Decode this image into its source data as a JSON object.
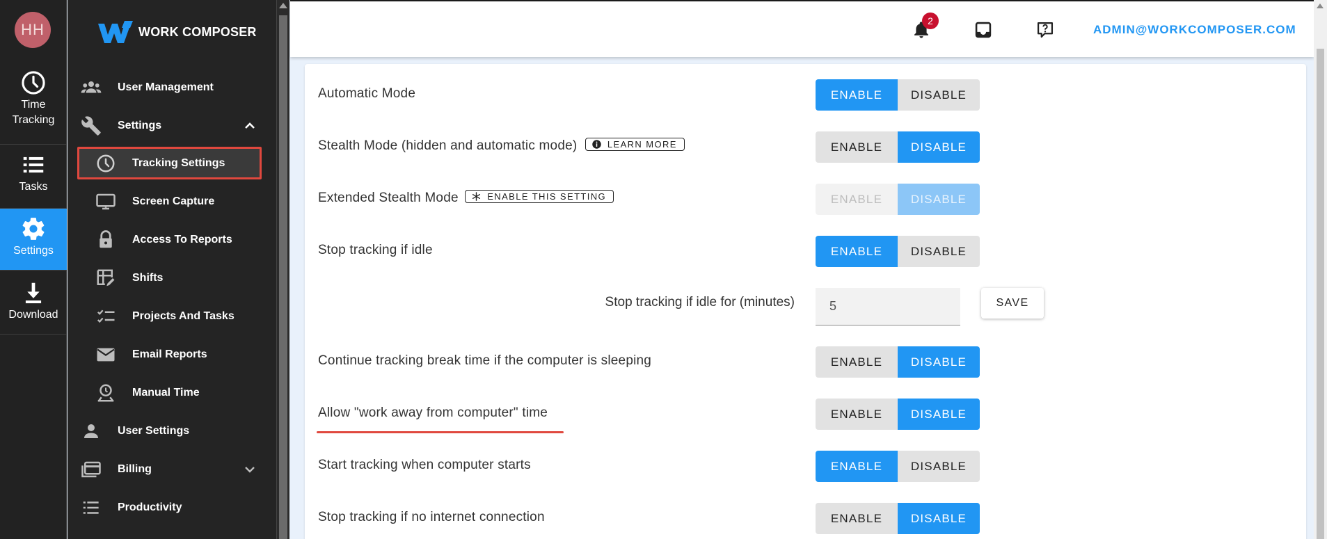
{
  "user": {
    "initials": "HH"
  },
  "rail": {
    "items": [
      {
        "label": "Time\nTracking",
        "line1": "Time",
        "line2": "Tracking",
        "icon": "clock-icon"
      },
      {
        "label": "Tasks",
        "icon": "list-icon"
      },
      {
        "label": "Settings",
        "icon": "gear-icon",
        "active": true
      },
      {
        "label": "Download",
        "icon": "download-icon"
      }
    ]
  },
  "nav": {
    "logo_text": "WORK COMPOSER",
    "items": [
      {
        "label": "User Management",
        "icon": "users-icon",
        "level": "top"
      },
      {
        "label": "Settings",
        "icon": "wrench-icon",
        "level": "top",
        "expanded": true
      },
      {
        "label": "Tracking Settings",
        "icon": "clock-icon",
        "level": "sub",
        "selected": true
      },
      {
        "label": "Screen Capture",
        "icon": "monitor-icon",
        "level": "sub"
      },
      {
        "label": "Access To Reports",
        "icon": "lock-icon",
        "level": "sub"
      },
      {
        "label": "Shifts",
        "icon": "schedule-icon",
        "level": "sub"
      },
      {
        "label": "Projects And Tasks",
        "icon": "checklist-icon",
        "level": "sub"
      },
      {
        "label": "Email Reports",
        "icon": "mail-icon",
        "level": "sub"
      },
      {
        "label": "Manual Time",
        "icon": "manual-time-icon",
        "level": "sub"
      },
      {
        "label": "User Settings",
        "icon": "person-icon",
        "level": "top"
      },
      {
        "label": "Billing",
        "icon": "billing-icon",
        "level": "top",
        "expanded": false
      },
      {
        "label": "Productivity",
        "icon": "list-icon",
        "level": "top"
      }
    ]
  },
  "header": {
    "notification_count": "2",
    "email": "ADMIN@WORKCOMPOSER.COM"
  },
  "colors": {
    "accent": "#2196f3",
    "highlight": "#e0483e",
    "badge": "#c8102e"
  },
  "settings": {
    "enable_label": "ENABLE",
    "disable_label": "DISABLE",
    "rows": [
      {
        "label": "Automatic Mode",
        "value": "enable"
      },
      {
        "label": "Stealth Mode (hidden and automatic mode)",
        "chip": "LEARN MORE",
        "chip_icon": "info-icon",
        "value": "disable"
      },
      {
        "label": "Extended Stealth Mode",
        "chip": "ENABLE THIS SETTING",
        "chip_icon": "asterisk-icon",
        "value": "disable",
        "disabled": true
      },
      {
        "label": "Stop tracking if idle",
        "value": "enable"
      },
      {
        "label": "Continue tracking break time if the computer is sleeping",
        "value": "disable"
      },
      {
        "label": "Allow \"work away from computer\" time",
        "value": "disable"
      },
      {
        "label": "Start tracking when computer starts",
        "value": "enable"
      },
      {
        "label": "Stop tracking if no internet connection",
        "value": "disable"
      }
    ],
    "idle": {
      "label": "Stop tracking if idle for (minutes)",
      "value": "5",
      "save_label": "SAVE"
    }
  }
}
